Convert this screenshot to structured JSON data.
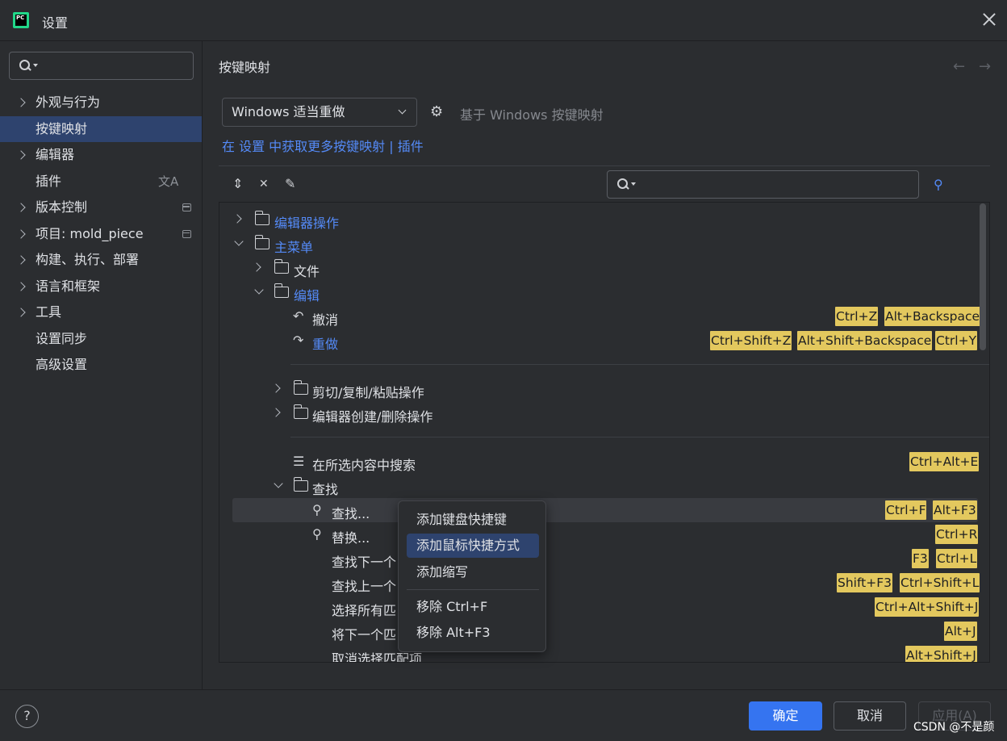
{
  "window": {
    "title": "设置",
    "logo_text": "PC"
  },
  "sidebar": {
    "search_placeholder": "",
    "items": [
      {
        "label": "外观与行为",
        "expandable": true
      },
      {
        "label": "按键映射",
        "selected": true
      },
      {
        "label": "编辑器",
        "expandable": true
      },
      {
        "label": "插件",
        "icon": "translate-icon",
        "icon_glyph": "文A"
      },
      {
        "label": "版本控制",
        "expandable": true
      },
      {
        "label": "项目: mold_piece",
        "expandable": true
      },
      {
        "label": "构建、执行、部署",
        "expandable": true
      },
      {
        "label": "语言和框架",
        "expandable": true
      },
      {
        "label": "工具",
        "expandable": true
      },
      {
        "label": "设置同步"
      },
      {
        "label": "高级设置"
      }
    ]
  },
  "main": {
    "title": "按键映射",
    "back_arrow": "←",
    "forward_arrow": "→",
    "scheme": "Windows 适当重做",
    "based_on": "基于 Windows 按键映射",
    "link": "在 设置 中获取更多按键映射 | 插件",
    "search_placeholder": "",
    "toolbar_glyphs": {
      "expand": "⇕",
      "collapse": "✕",
      "edit": "✎",
      "gear": "⚙",
      "find_shortcut": "⚲"
    }
  },
  "tree": {
    "rows": [
      {
        "label": "编辑器操作",
        "blue": true
      },
      {
        "label": "主菜单",
        "blue": true
      },
      {
        "label": "文件"
      },
      {
        "label": "编辑",
        "blue": true
      },
      {
        "label": "撤消",
        "glyph": "↶",
        "shortcuts": [
          "Ctrl+Z",
          "Alt+Backspace"
        ]
      },
      {
        "label": "重做",
        "blue": true,
        "glyph": "↷",
        "shortcuts": [
          "Ctrl+Shift+Z",
          "Alt+Shift+Backspace",
          "Ctrl+Y"
        ]
      },
      {
        "label": "剪切/复制/粘贴操作"
      },
      {
        "label": "编辑器创建/删除操作"
      },
      {
        "label": "在所选内容中搜索",
        "glyph": "☰",
        "shortcuts": [
          "Ctrl+Alt+E"
        ]
      },
      {
        "label": "查找"
      },
      {
        "label": "查找...",
        "glyph": "⚲",
        "shortcuts": [
          "Ctrl+F",
          "Alt+F3"
        ],
        "highlighted": true
      },
      {
        "label": "替换...",
        "glyph": "⚲",
        "shortcuts": [
          "Ctrl+R"
        ]
      },
      {
        "label": "查找下一个",
        "shortcuts": [
          "F3",
          "Ctrl+L"
        ]
      },
      {
        "label": "查找上一个",
        "shortcuts": [
          "Shift+F3",
          "Ctrl+Shift+L"
        ]
      },
      {
        "label": "选择所有匹",
        "shortcuts": [
          "Ctrl+Alt+Shift+J"
        ]
      },
      {
        "label": "将下一个匹",
        "shortcuts": [
          "Alt+J"
        ]
      },
      {
        "label": "取消选择匹配项",
        "shortcuts": [
          "Alt+Shift+J"
        ]
      }
    ]
  },
  "context_menu": {
    "items": [
      {
        "label": "添加键盘快捷键"
      },
      {
        "label": "添加鼠标快捷方式",
        "active": true
      },
      {
        "label": "添加缩写"
      },
      {
        "label": "移除 Ctrl+F"
      },
      {
        "label": "移除 Alt+F3"
      }
    ]
  },
  "footer": {
    "help": "?",
    "ok": "确定",
    "cancel": "取消",
    "apply": "应用(A)",
    "watermark": "CSDN @不是颜"
  },
  "colors": {
    "background": "#2b2d30",
    "selection": "#2e436e",
    "accent": "#3574f0",
    "link": "#548af7",
    "shortcut_badge": "#e3c85e"
  }
}
